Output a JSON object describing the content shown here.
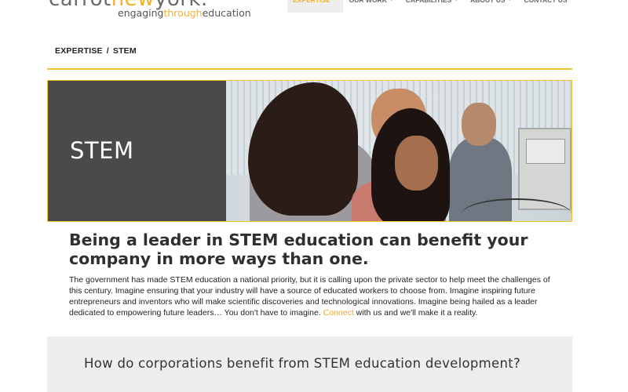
{
  "header": {
    "logo": {
      "main_pre": "carrot",
      "main_acc": "new",
      "main_post": "york.",
      "tag_pre": "engaging",
      "tag_acc": "through",
      "tag_post": "education"
    },
    "nav": [
      {
        "label": "EXPERTISE",
        "active": true
      },
      {
        "label": "OUR WORK",
        "active": false
      },
      {
        "label": "CAPABILITIES",
        "active": false
      },
      {
        "label": "ABOUT US",
        "active": false
      },
      {
        "label": "CONTACT US",
        "active": false
      }
    ]
  },
  "breadcrumb": {
    "items": [
      "EXPERTISE",
      "STEM"
    ],
    "separator": "/"
  },
  "hero": {
    "title": "STEM"
  },
  "content": {
    "headline": "Being a leader in STEM education can benefit your company in more ways than one.",
    "body_pre": "The government has made STEM education a national priority, but it is calling upon the private sector to help meet the challenges of this century. Imagine ensuring that your industry will have a source of educated workers to choose from. Imagine inspiring future entrepreneurs and inventors who will make scientific discoveries and technological innovations. Imagine being hailed as a leader dedicated to empowering future leaders… You don't have to imagine. ",
    "body_link": "Connect",
    "body_post": " with us and we'll make it a reality."
  },
  "question": {
    "text": "How do corporations benefit from STEM education development?"
  },
  "colors": {
    "accent": "#f2b227",
    "hero_box": "#4a4a4a",
    "band": "#eeeeee"
  }
}
